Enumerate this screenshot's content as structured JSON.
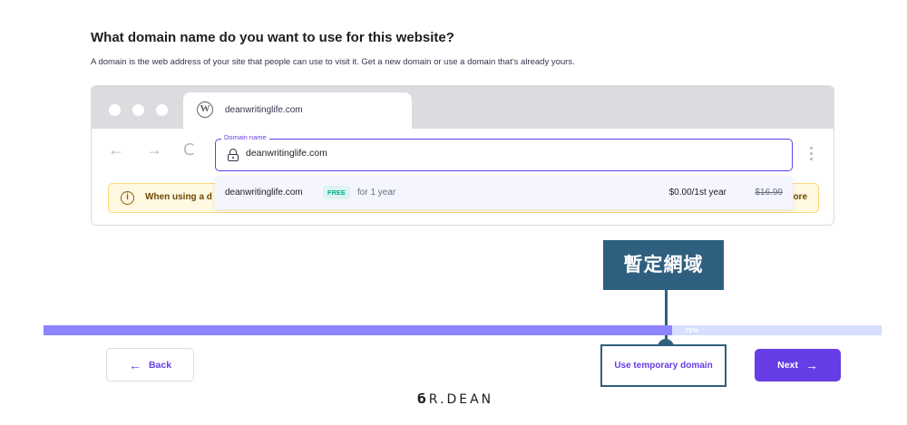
{
  "page": {
    "heading": "What domain name do you want to use for this website?",
    "subtext": "A domain is the web address of your site that people can use to visit it. Get a new domain or use a domain that’s already yours."
  },
  "browser": {
    "tab_url": "deanwritinglife.com",
    "wp_glyph": "W",
    "back_arrow": "←",
    "forward_arrow": "→",
    "reload_glyph": "C",
    "warning_text": "When using a d",
    "warning_more": "ore",
    "warning_icon_glyph": "i"
  },
  "domain_field": {
    "label": "Domain name",
    "value": "deanwritinglife.com"
  },
  "suggestion": {
    "domain": "deanwritinglife.com",
    "badge": "FREE",
    "term": "for 1 year",
    "price": "$0.00/1st year",
    "old_price": "$16.99"
  },
  "annotation": {
    "label": "暫定網域"
  },
  "progress": {
    "label": "75%",
    "percent": 75
  },
  "buttons": {
    "back": "Back",
    "back_arrow": "←",
    "temporary_domain": "Use temporary domain",
    "next": "Next",
    "next_arrow": "→"
  },
  "logo": {
    "mark": "б",
    "text": "R.DEAN"
  },
  "colors": {
    "accent": "#673de6",
    "annotation": "#2f5f7e",
    "progress_fill": "#8c85ff",
    "progress_track": "#d5dfff"
  }
}
